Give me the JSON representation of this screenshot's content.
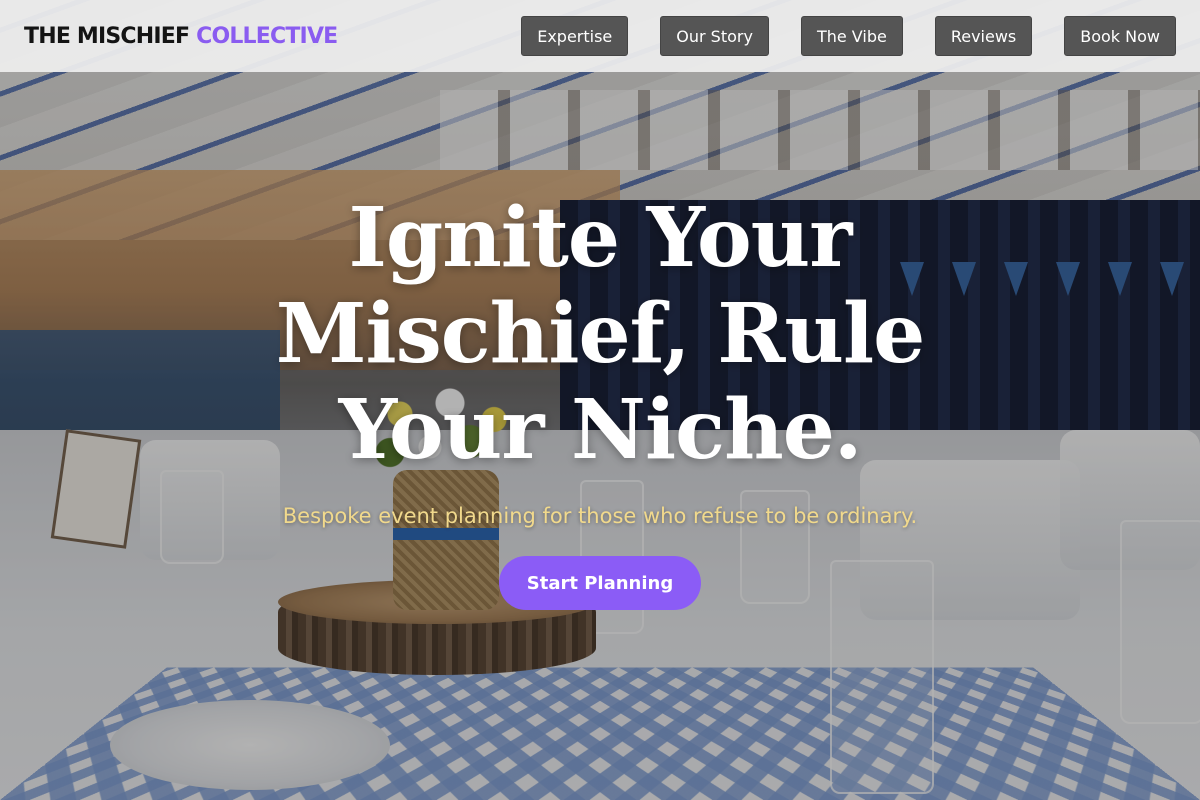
{
  "brand": {
    "name_primary": "THE MISCHIEF",
    "name_accent": "COLLECTIVE",
    "accent_color": "#8a5cf0"
  },
  "nav": {
    "items": [
      {
        "label": "Expertise"
      },
      {
        "label": "Our Story"
      },
      {
        "label": "The Vibe"
      },
      {
        "label": "Reviews"
      },
      {
        "label": "Book Now"
      }
    ],
    "button_color": "#555555"
  },
  "hero": {
    "title": "Ignite Your Mischief, Rule Your Niche.",
    "subtitle": "Bespoke event planning for those who refuse to be ordinary.",
    "subtitle_color": "#f1d98c",
    "cta_label": "Start Planning",
    "cta_color": "#8b5cf6",
    "background_image": "decorated banquet hall with blue-and-white tent ceiling, table settings, wood stump centerpiece and flowers"
  }
}
